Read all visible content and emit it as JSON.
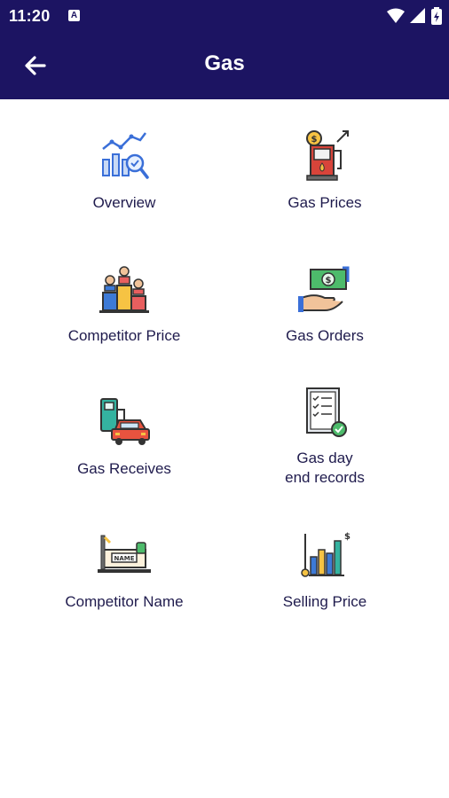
{
  "status": {
    "time": "11:20",
    "notif": "A"
  },
  "header": {
    "title": "Gas"
  },
  "tiles": [
    {
      "label": "Overview",
      "icon": "analytics-chart-icon"
    },
    {
      "label": "Gas Prices",
      "icon": "gas-pump-price-icon"
    },
    {
      "label": "Competitor Price",
      "icon": "podium-competitors-icon"
    },
    {
      "label": "Gas Orders",
      "icon": "money-hand-icon"
    },
    {
      "label": "Gas Receives",
      "icon": "car-fuel-pump-icon"
    },
    {
      "label_line1": "Gas day",
      "label_line2": "end records",
      "icon": "checklist-document-icon"
    },
    {
      "label": "Competitor Name",
      "icon": "name-plate-icon"
    },
    {
      "label": "Selling Price",
      "icon": "price-bar-chart-icon"
    }
  ],
  "colors": {
    "primary": "#1c1462",
    "label": "#1f1b4d"
  }
}
